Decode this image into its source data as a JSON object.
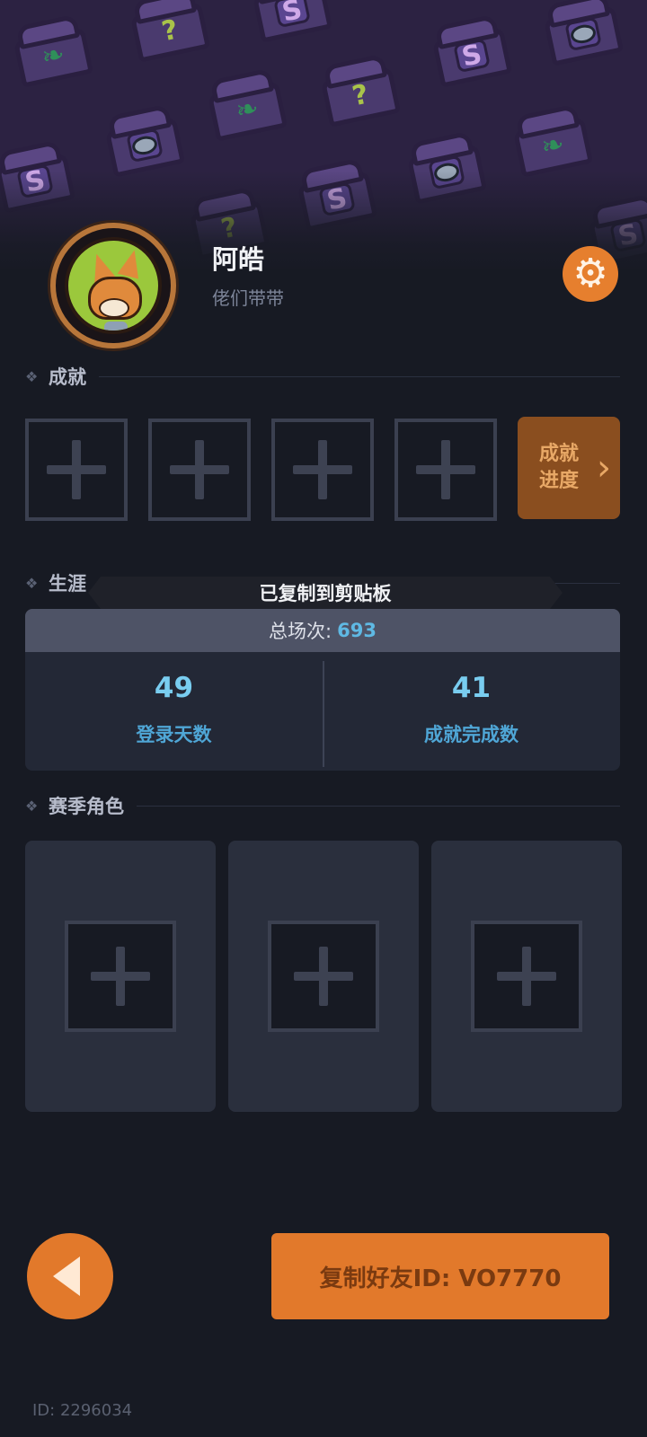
{
  "profile": {
    "name": "阿皓",
    "subtitle": "佬们带带"
  },
  "achievements": {
    "section_title": "成就",
    "progress_label": "成就进度"
  },
  "toast": {
    "text": "已复制到剪贴板"
  },
  "career": {
    "section_title": "生涯",
    "total_label": "总场次:",
    "total_value": "693",
    "stats": [
      {
        "value": "49",
        "label": "登录天数"
      },
      {
        "value": "41",
        "label": "成就完成数"
      }
    ]
  },
  "season_roles": {
    "section_title": "赛季角色"
  },
  "actions": {
    "copy_friend_id": "复制好友ID: VO7770"
  },
  "footer": {
    "id_text": "ID: 2296034"
  },
  "colors": {
    "accent_orange": "#e2792b",
    "stat_blue": "#79cdf0",
    "background": "#171a23"
  },
  "icons": [
    "gear-icon",
    "plus-icon",
    "chevron-right-icon",
    "back-arrow-icon",
    "diamond-bullet-icon"
  ]
}
